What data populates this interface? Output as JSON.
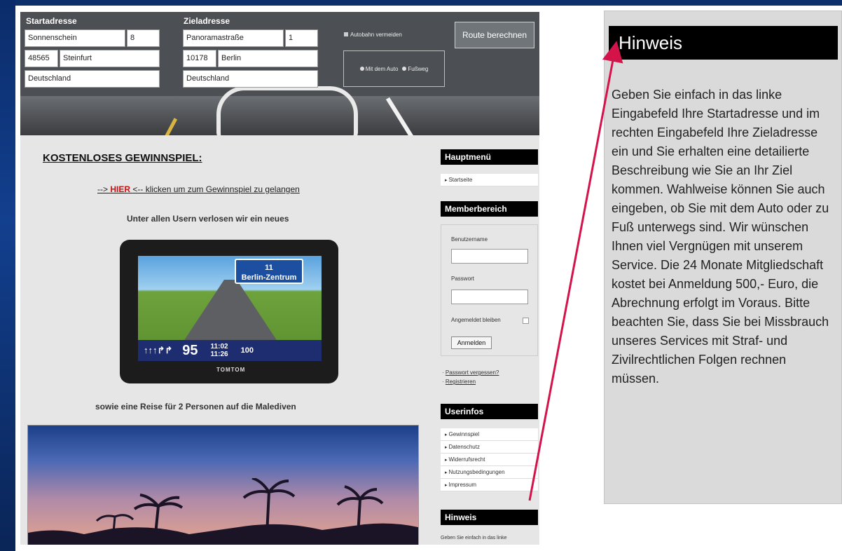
{
  "form": {
    "start_label": "Startadresse",
    "ziel_label": "Zieladresse",
    "start_street": "Sonnenschein",
    "start_number": "8",
    "start_zip": "48565",
    "start_city": "Steinfurt",
    "start_country": "Deutschland",
    "ziel_street": "Panoramastraße",
    "ziel_number": "1",
    "ziel_zip": "10178",
    "ziel_city": "Berlin",
    "ziel_country": "Deutschland",
    "avoid_highway": "Autobahn vermeiden",
    "route_button": "Route berechnen",
    "mode_car": "Mit dem Auto",
    "mode_walk": "Fußweg"
  },
  "main": {
    "heading": "KOSTENLOSES GEWINNSPIEL:",
    "hier_prefix": "-->",
    "hier_word": "HIER",
    "hier_suffix": "<-- klicken um zum Gewinnspiel zu gelangen",
    "text1": "Unter allen Usern verlosen wir ein neues",
    "text2": "sowie eine Reise für 2 Personen auf die Malediven",
    "nav_sign_num": "11",
    "nav_sign": "Berlin-Zentrum",
    "nav_distance": "95",
    "nav_time1": "11:02",
    "nav_time2": "11:26",
    "nav_speed": "100",
    "nav_brand": "TOMTOM"
  },
  "sidebar": {
    "hauptmenu_title": "Hauptmenü",
    "hauptmenu_items": [
      "Startseite"
    ],
    "member_title": "Memberbereich",
    "username_label": "Benutzername",
    "password_label": "Passwort",
    "remember_label": "Angemeldet bleiben",
    "login_button": "Anmelden",
    "forgot_link": "Passwort vergessen?",
    "register_link": "Registrieren",
    "userinfos_title": "Userinfos",
    "userinfos_items": [
      "Gewinnspiel",
      "Datenschutz",
      "Widerrufsrecht",
      "Nutzungsbedingungen",
      "Impressum"
    ],
    "hinweis_title": "Hinweis",
    "hinweis_snippet": "Geben Sie einfach in das linke"
  },
  "panel": {
    "title": "Hinweis",
    "body": "Geben Sie einfach in das linke Eingabefeld Ihre Startadresse und im rechten Eingabefeld Ihre Zieladresse ein und Sie erhalten eine detailierte Beschreibung wie Sie an Ihr Ziel kommen. Wahlweise können Sie auch eingeben, ob Sie mit dem Auto oder zu Fuß unterwegs sind. Wir wünschen Ihnen viel Vergnügen mit unserem Service. Die 24 Monate Mitgliedschaft kostet bei Anmeldung 500,- Euro, die Abrechnung erfolgt im Voraus. Bitte beachten Sie, dass Sie bei Missbrauch unseres Services mit Straf- und Zivilrechtlichen Folgen rechnen müssen."
  },
  "colors": {
    "arrow": "#d4134a",
    "link_red": "#d01010"
  }
}
